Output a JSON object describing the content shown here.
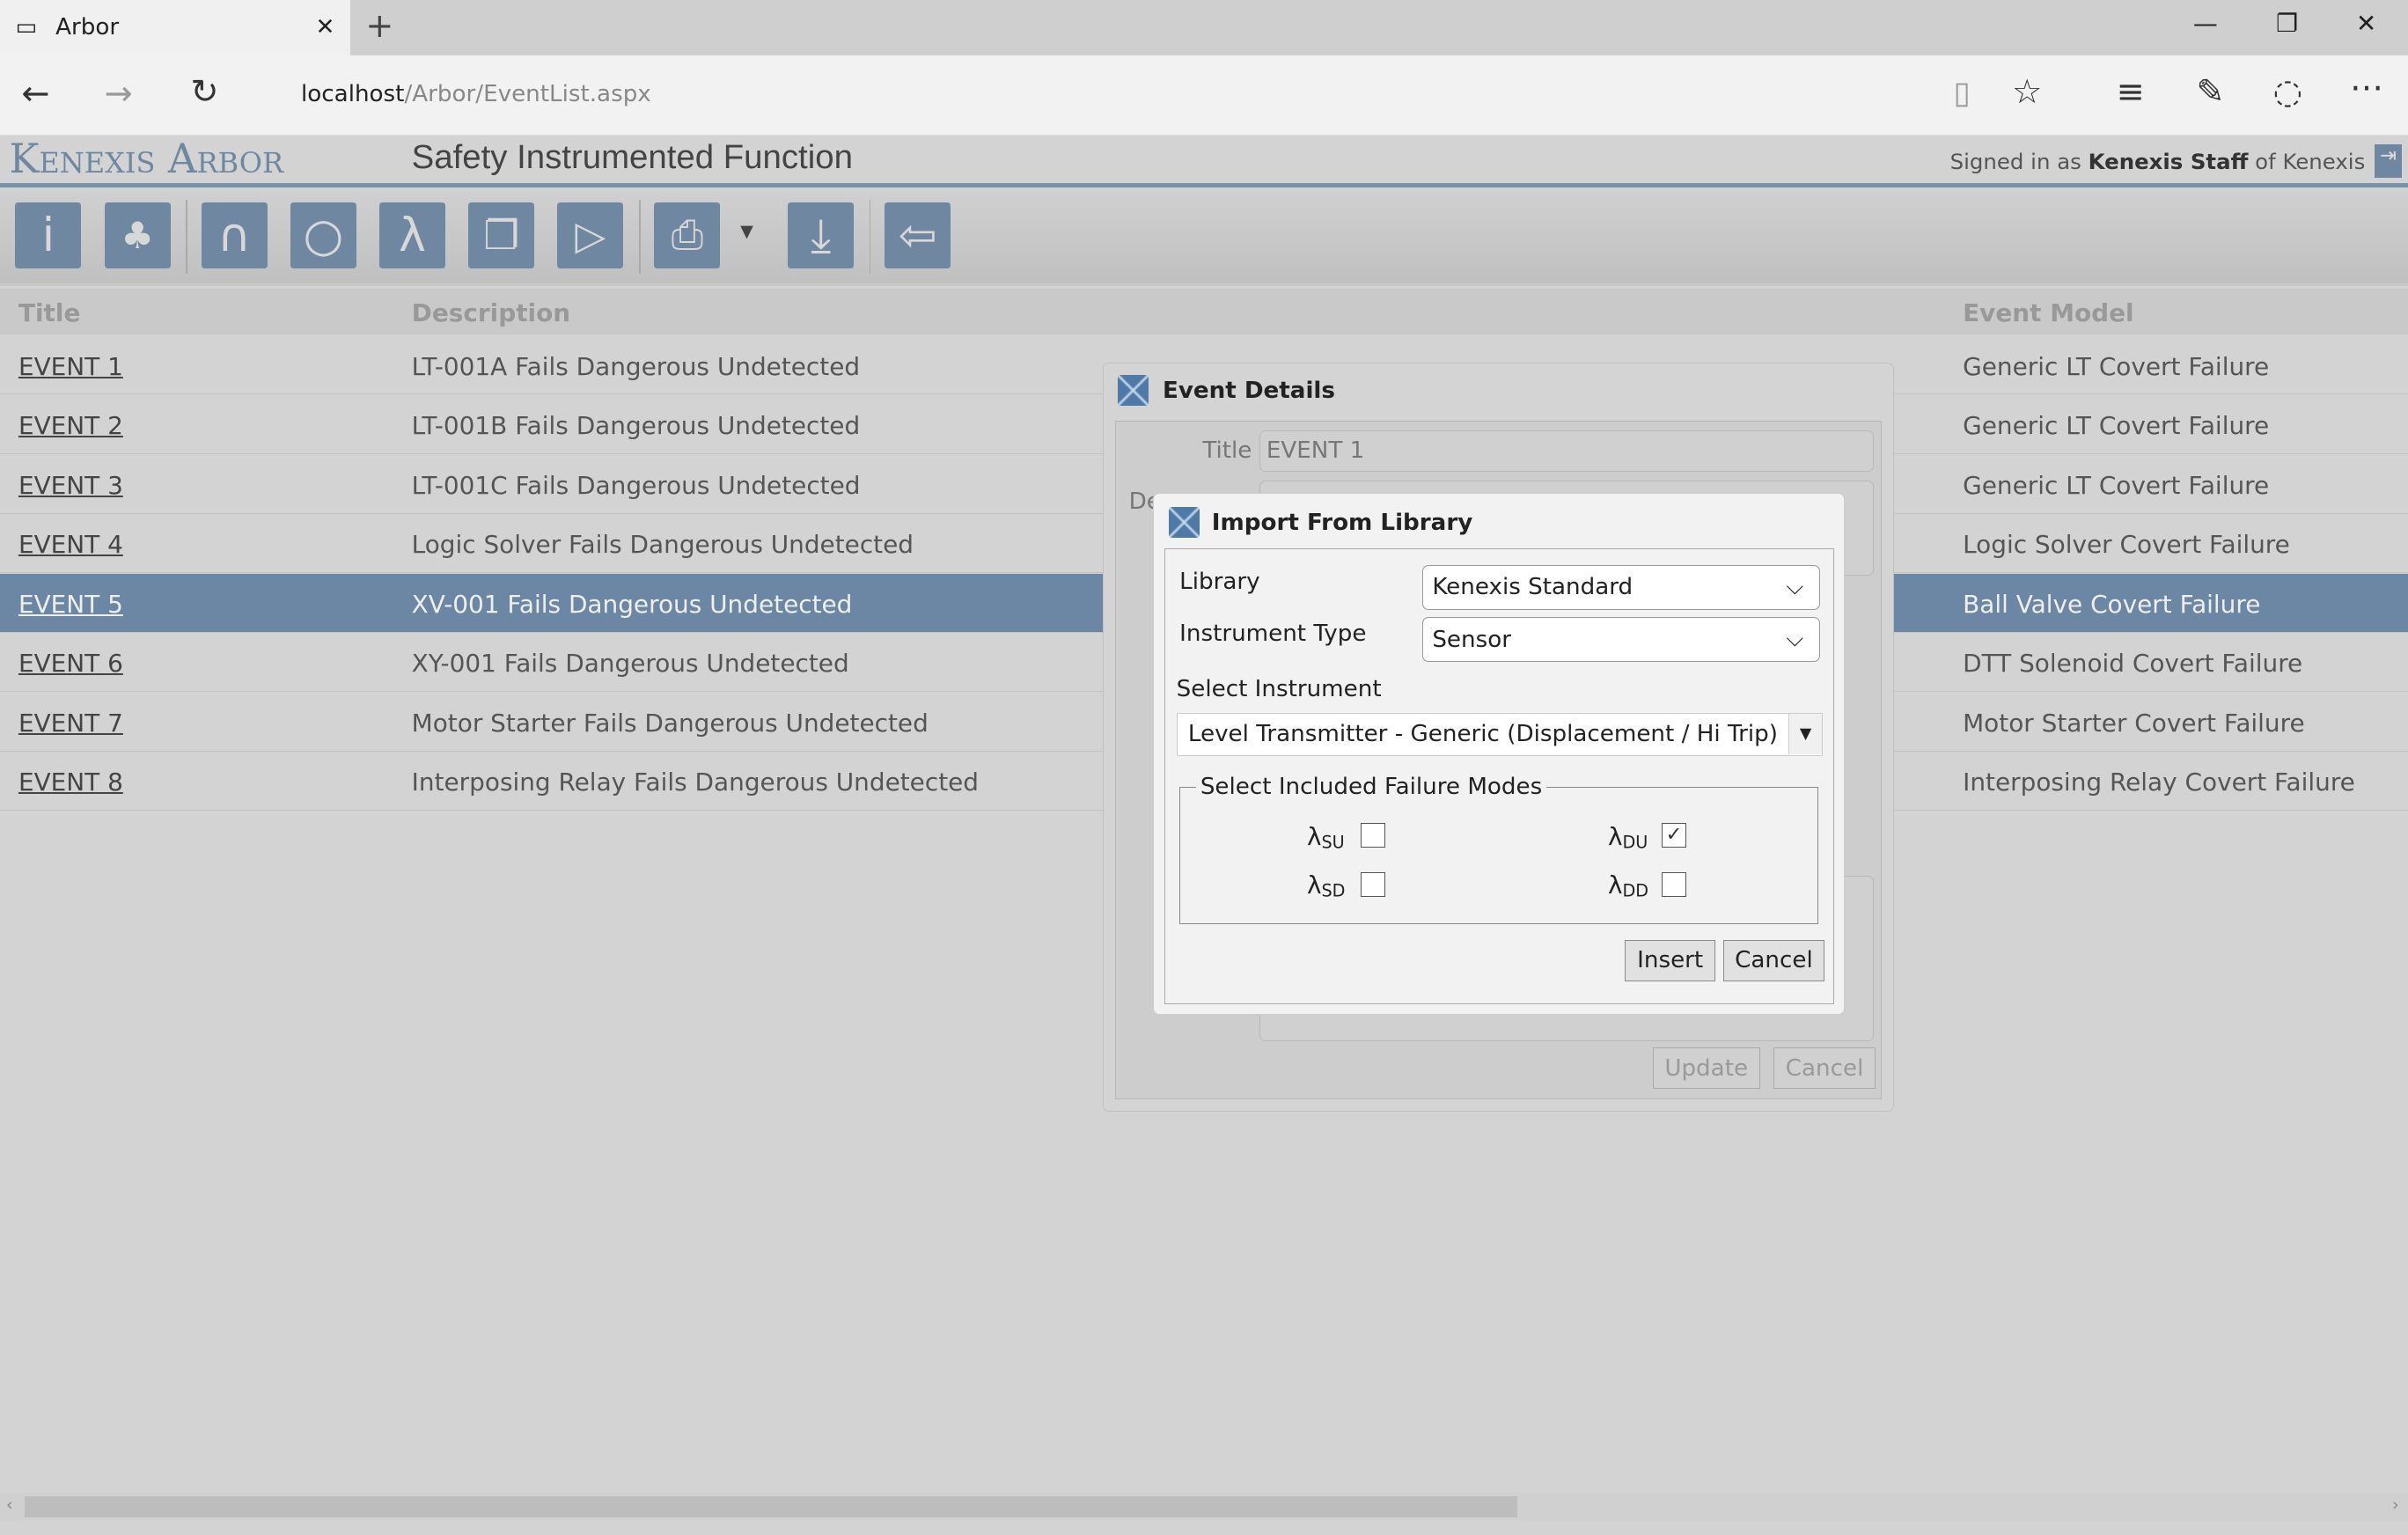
{
  "browser": {
    "tab_title": "Arbor",
    "url_host": "localhost",
    "url_path": "/Arbor/EventList.aspx"
  },
  "app": {
    "logo": "Kenexis Arbor",
    "page_title": "Safety Instrumented Function",
    "signed_prefix": "Signed in as ",
    "user": "Kenexis Staff",
    "signed_mid": " of ",
    "org": "Kenexis"
  },
  "toolbar": {
    "icons": [
      "info-icon",
      "hierarchy-icon",
      "bell-shape-icon",
      "circle-icon",
      "lambda-icon",
      "copy-icon",
      "play-icon",
      "printer-icon",
      "download-icon",
      "back-arrow-icon"
    ],
    "accent": "#6f87a0"
  },
  "table": {
    "columns": [
      "Title",
      "Description",
      "Event Model"
    ],
    "rows": [
      {
        "title": "EVENT 1",
        "description": "LT-001A Fails Dangerous Undetected",
        "model": "Generic LT Covert Failure"
      },
      {
        "title": "EVENT 2",
        "description": "LT-001B Fails Dangerous Undetected",
        "model": "Generic LT Covert Failure"
      },
      {
        "title": "EVENT 3",
        "description": "LT-001C Fails Dangerous Undetected",
        "model": "Generic LT Covert Failure"
      },
      {
        "title": "EVENT 4",
        "description": "Logic Solver Fails Dangerous Undetected",
        "model": "Logic Solver Covert Failure"
      },
      {
        "title": "EVENT 5",
        "description": "XV-001 Fails Dangerous Undetected",
        "model": "Ball Valve Covert Failure",
        "selected": true
      },
      {
        "title": "EVENT 6",
        "description": "XY-001 Fails Dangerous Undetected",
        "model": "DTT Solenoid Covert Failure"
      },
      {
        "title": "EVENT 7",
        "description": "Motor Starter Fails Dangerous Undetected",
        "model": "Motor Starter Covert Failure"
      },
      {
        "title": "EVENT 8",
        "description": "Interposing Relay Fails Dangerous Undetected",
        "model": "Interposing Relay Covert Failure"
      }
    ]
  },
  "event_dialog": {
    "title": "Event Details",
    "title_label": "Title",
    "title_value": "EVENT 1",
    "desc_label_partial": "De",
    "update": "Update",
    "cancel": "Cancel"
  },
  "import_dialog": {
    "title": "Import From Library",
    "library_label": "Library",
    "library_value": "Kenexis Standard",
    "type_label": "Instrument Type",
    "type_value": "Sensor",
    "instrument_label": "Select Instrument",
    "instrument_value": "Level Transmitter - Generic (Displacement / Hi Trip)",
    "modes_legend": "Select Included Failure Modes",
    "modes": [
      {
        "sym": "λ",
        "sub": "SU",
        "checked": false
      },
      {
        "sym": "λ",
        "sub": "DU",
        "checked": true
      },
      {
        "sym": "λ",
        "sub": "SD",
        "checked": false
      },
      {
        "sym": "λ",
        "sub": "DD",
        "checked": false
      }
    ],
    "insert": "Insert",
    "cancel": "Cancel"
  }
}
